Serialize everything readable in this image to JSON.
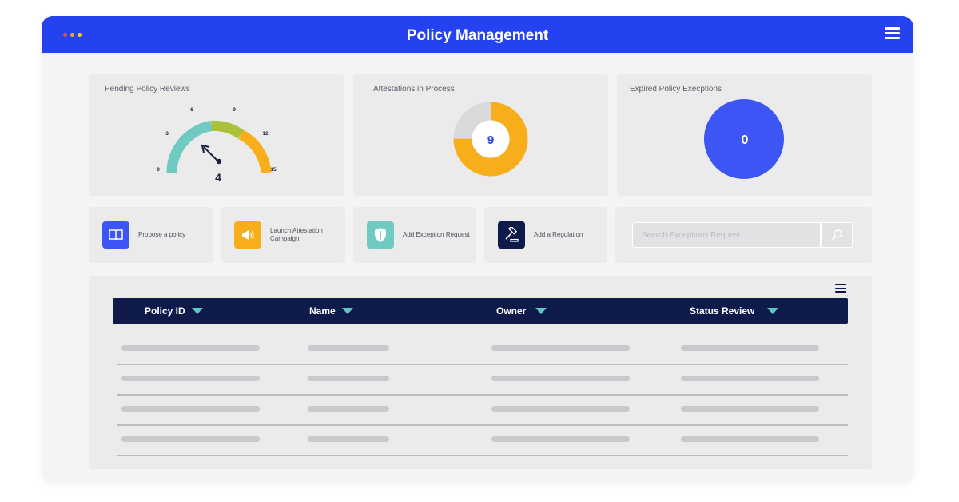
{
  "window": {
    "title": "Policy Management",
    "dot_colors": [
      "#e94b3c",
      "#f4a51c",
      "#f2d21b"
    ]
  },
  "colors": {
    "titlebar": "#2442f0",
    "header_navy": "#0d1a4a",
    "teal": "#6fcac2",
    "green": "#a9c23a",
    "orange": "#f7ae1a",
    "blue": "#3d55f5"
  },
  "widgets": {
    "pending": {
      "title": "Pending Policy Reviews",
      "value": "4",
      "scale_labels": [
        "0",
        "3",
        "6",
        "9",
        "12",
        "15"
      ]
    },
    "attestations": {
      "title": "Attestations in Process",
      "value": "9",
      "filled_fraction": 0.75
    },
    "expired": {
      "title": "Expired Policy Execptions",
      "value": "0"
    }
  },
  "actions": [
    {
      "label": "Propose a policy",
      "icon": "book-icon",
      "color": "#3d55f5"
    },
    {
      "label": "Launch Attestation Campaign",
      "icon": "megaphone-icon",
      "color": "#f7ae1a"
    },
    {
      "label": "Add Exception Request",
      "icon": "shield-alert-icon",
      "color": "#6fcac2"
    },
    {
      "label": "Add a Regulation",
      "icon": "gavel-icon",
      "color": "#0d1a4a"
    }
  ],
  "search": {
    "placeholder": "Search Exceptions Request",
    "icon": "search-icon"
  },
  "table": {
    "columns": [
      "Policy ID",
      "Name",
      "Owner",
      "Status Review"
    ]
  }
}
